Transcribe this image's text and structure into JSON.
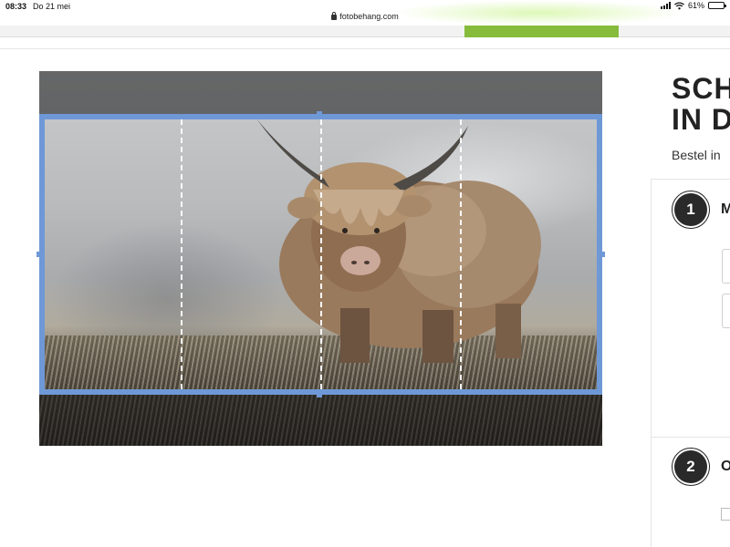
{
  "status_bar": {
    "time": "08:33",
    "date": "Do 21 mei",
    "battery_percent": "61%",
    "battery_level": 0.61,
    "icons": [
      "signal-icon",
      "wifi-icon",
      "battery-icon"
    ]
  },
  "browser": {
    "url": "fotobehang.com"
  },
  "colors": {
    "brand_green": "#86bb3c",
    "crop_frame": "#6f98d6",
    "heading_text": "#222222"
  },
  "editor": {
    "photo_subject": "highland-cow-photo",
    "panel_count": 4
  },
  "config": {
    "heading_line1": "SCH",
    "heading_line2": "IN D",
    "subtitle": "Bestel in",
    "steps": [
      {
        "number": "1",
        "title": "M"
      },
      {
        "number": "2",
        "title": "O"
      }
    ]
  }
}
